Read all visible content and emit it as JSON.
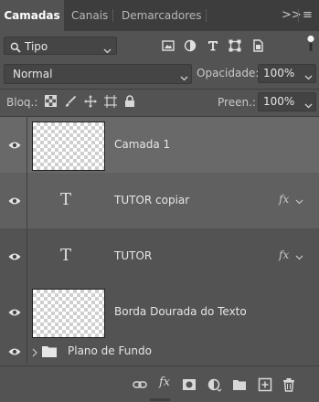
{
  "tabs": [
    {
      "label": "Camadas",
      "active": true
    },
    {
      "label": "Canais",
      "active": false
    },
    {
      "label": "Demarcadores",
      "active": false
    }
  ],
  "tab_controls": {
    "collapse": ">>",
    "menu": "≡"
  },
  "filter": {
    "selected": "Tipo",
    "icons": [
      "image-filter-icon",
      "adjustment-filter-icon",
      "type-filter-icon",
      "shape-filter-icon",
      "smart-object-filter-icon"
    ]
  },
  "blend": {
    "mode": "Normal",
    "opacity_label": "Opacidade:",
    "opacity": "100%"
  },
  "lock": {
    "label": "Bloq.:",
    "icons": [
      "lock-transparent-icon",
      "lock-image-icon",
      "lock-position-icon",
      "lock-artboard-icon",
      "lock-all-icon"
    ],
    "fill_label": "Preen.:",
    "fill": "100%"
  },
  "layers": [
    {
      "name": "Camada 1",
      "kind": "pixel",
      "selected": true,
      "visible": true
    },
    {
      "name": "TUTOR copiar",
      "kind": "text",
      "fx": "fx",
      "visible": true
    },
    {
      "name": "TUTOR",
      "kind": "text",
      "fx": "fx",
      "visible": true
    },
    {
      "name": "Borda Dourada do Texto",
      "kind": "pixel",
      "visible": true
    },
    {
      "name": "Plano de Fundo",
      "kind": "group",
      "visible": true
    }
  ],
  "text_glyph": "T",
  "footer_icons": [
    "link-layers-icon",
    "fx-icon",
    "mask-icon",
    "adjustment-layer-icon",
    "new-group-icon",
    "new-layer-icon",
    "delete-icon"
  ],
  "footer_fx_glyph": "fx",
  "colors": {
    "panel": "#535353",
    "tabbar": "#3d3d3d",
    "selected_row": "#696969"
  }
}
